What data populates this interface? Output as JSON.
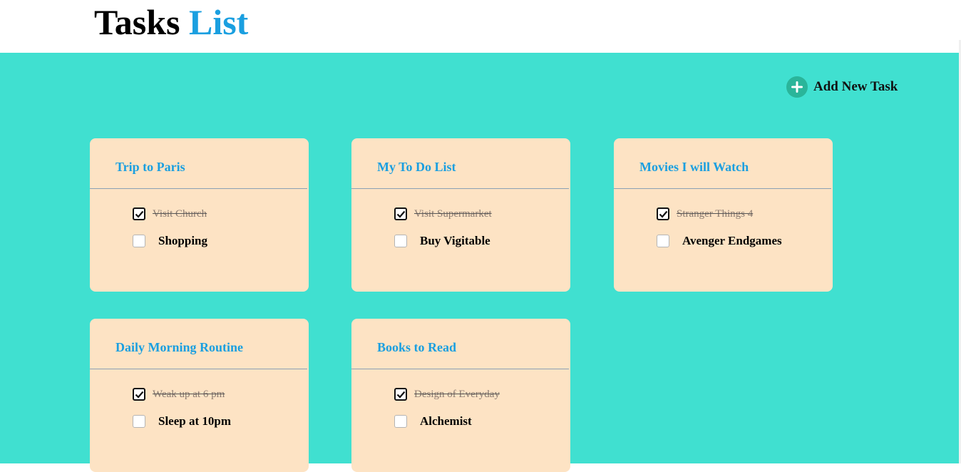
{
  "page": {
    "title_main": "Tasks",
    "title_accent": "List"
  },
  "colors": {
    "background": "#40e0d0",
    "card": "#fde3c4",
    "accent": "#1a9fe0",
    "add_icon": "#2ab59a"
  },
  "toolbar": {
    "add_label": "Add New Task",
    "add_icon": "plus-circle-icon"
  },
  "cards": [
    {
      "title": "Trip to Paris",
      "tasks": [
        {
          "label": "Visit Church",
          "done": true
        },
        {
          "label": "Shopping",
          "done": false
        }
      ]
    },
    {
      "title": "My To Do List",
      "tasks": [
        {
          "label": "Visit Supermarket",
          "done": true
        },
        {
          "label": "Buy Vigitable",
          "done": false
        }
      ]
    },
    {
      "title": "Movies I will Watch",
      "tasks": [
        {
          "label": "Stranger Things 4",
          "done": true
        },
        {
          "label": "Avenger Endgames",
          "done": false
        }
      ]
    },
    {
      "title": "Daily Morning Routine",
      "tasks": [
        {
          "label": "Weak up at 6 pm",
          "done": true
        },
        {
          "label": "Sleep at 10pm",
          "done": false
        }
      ]
    },
    {
      "title": "Books to Read",
      "tasks": [
        {
          "label": "Design of Everyday",
          "done": true
        },
        {
          "label": "Alchemist",
          "done": false
        }
      ]
    }
  ]
}
